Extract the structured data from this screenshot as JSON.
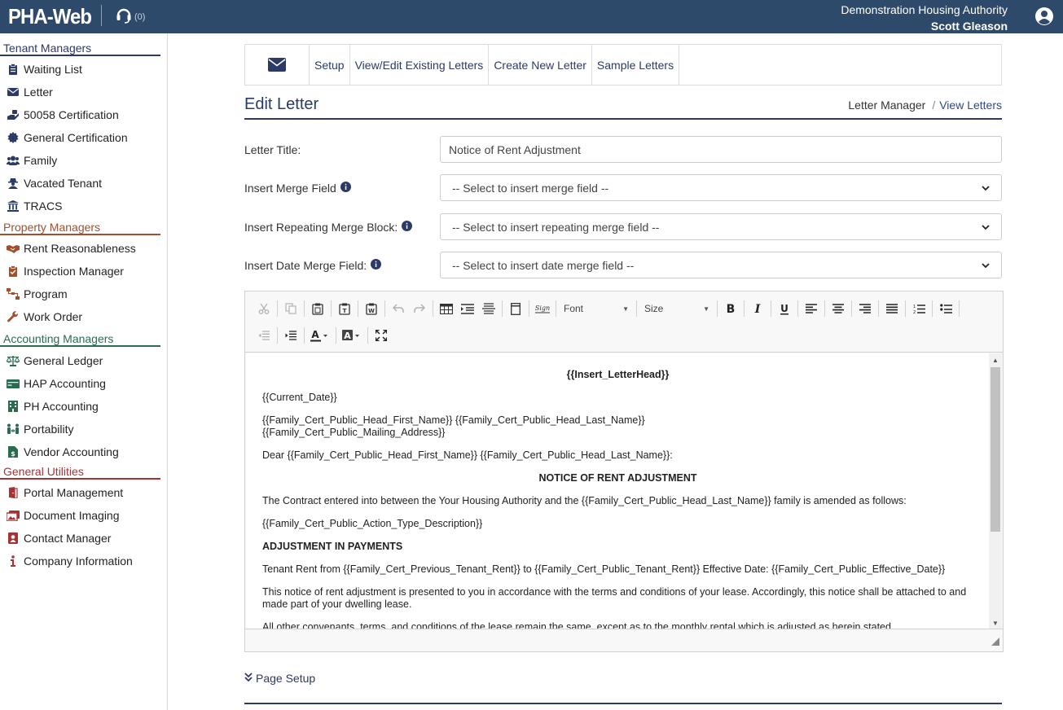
{
  "header": {
    "logo": "PHA-Web",
    "support_count": "(0)",
    "org_name": "Demonstration Housing Authority",
    "user_name": "Scott Gleason"
  },
  "sidebar": {
    "tenant": {
      "title": "Tenant Managers",
      "items": [
        {
          "label": "Waiting List",
          "icon": "clipboard-icon"
        },
        {
          "label": "Letter",
          "icon": "envelope-icon"
        },
        {
          "label": "50058 Certification",
          "icon": "hand-holding-icon"
        },
        {
          "label": "General Certification",
          "icon": "certificate-icon"
        },
        {
          "label": "Family",
          "icon": "users-icon"
        },
        {
          "label": "Vacated Tenant",
          "icon": "user-secret-icon"
        },
        {
          "label": "TRACS",
          "icon": "landmark-icon"
        }
      ]
    },
    "property": {
      "title": "Property Managers",
      "items": [
        {
          "label": "Rent Reasonableness",
          "icon": "handshake-icon"
        },
        {
          "label": "Inspection Manager",
          "icon": "clipboard-check-icon"
        },
        {
          "label": "Program",
          "icon": "sitemap-icon"
        },
        {
          "label": "Work Order",
          "icon": "wrench-icon"
        }
      ]
    },
    "accounting": {
      "title": "Accounting Managers",
      "items": [
        {
          "label": "General Ledger",
          "icon": "balance-scale-icon"
        },
        {
          "label": "HAP Accounting",
          "icon": "money-bill-icon"
        },
        {
          "label": "PH Accounting",
          "icon": "building-icon"
        },
        {
          "label": "Portability",
          "icon": "people-arrows-icon"
        },
        {
          "label": "Vendor Accounting",
          "icon": "file-invoice-dollar-icon"
        }
      ]
    },
    "general": {
      "title": "General Utilities",
      "items": [
        {
          "label": "Portal Management",
          "icon": "door-open-icon"
        },
        {
          "label": "Document Imaging",
          "icon": "images-icon"
        },
        {
          "label": "Contact Manager",
          "icon": "address-book-icon"
        },
        {
          "label": "Company Information",
          "icon": "info-icon"
        }
      ]
    }
  },
  "tabs": {
    "setup": "Setup",
    "view_edit": "View/Edit Existing Letters",
    "create": "Create New Letter",
    "samples": "Sample Letters"
  },
  "page": {
    "title": "Edit Letter",
    "breadcrumb_root": "Letter Manager",
    "breadcrumb_sep": "/",
    "breadcrumb_current": "View Letters"
  },
  "form": {
    "title_label": "Letter Title:",
    "title_value": "Notice of Rent Adjustment",
    "merge_label": "Insert Merge Field",
    "merge_value": "-- Select to insert merge field --",
    "repeat_label": "Insert Repeating Merge Block:",
    "repeat_value": "-- Select to insert repeating merge field --",
    "date_label": "Insert Date Merge Field:",
    "date_value": "-- Select to insert date merge field --"
  },
  "editor": {
    "font_label": "Font",
    "size_label": "Size",
    "sign_label": "Sign",
    "doc": {
      "letterhead": "{{Insert_LetterHead}}",
      "current_date": "{{Current_Date}}",
      "address_line1": "{{Family_Cert_Public_Head_First_Name}} {{Family_Cert_Public_Head_Last_Name}}",
      "address_line2": "{{Family_Cert_Public_Mailing_Address}}",
      "greeting": "Dear {{Family_Cert_Public_Head_First_Name}} {{Family_Cert_Public_Head_Last_Name}}:",
      "heading": "NOTICE OF RENT ADJUSTMENT",
      "contract": "The Contract entered into between the Your Housing Authority and the {{Family_Cert_Public_Head_Last_Name}} family is amended as follows:",
      "action": "{{Family_Cert_Public_Action_Type_Description}}",
      "adjust_heading": "ADJUSTMENT IN PAYMENTS",
      "tenant_rent": "Tenant Rent from {{Family_Cert_Previous_Tenant_Rent}} to {{Family_Cert_Public_Tenant_Rent}} Effective Date: {{Family_Cert_Public_Effective_Date}}",
      "notice": "This notice of rent adjustment is presented to you in accordance with the terms and conditions of your lease. Accordingly, this notice shall be attached to and made part of your dwelling lease.",
      "covenants": "All other convenants, terms, and conditions of the lease remain the same, except as to the monthly rental which is adjusted as herein stated."
    }
  },
  "footer": {
    "page_setup": "Page Setup"
  },
  "colors": {
    "header_bg": "#2e4a6b",
    "navy": "#2b3a67",
    "property": "#a0502c",
    "accounting": "#2b6b4e",
    "general": "#a83232"
  }
}
